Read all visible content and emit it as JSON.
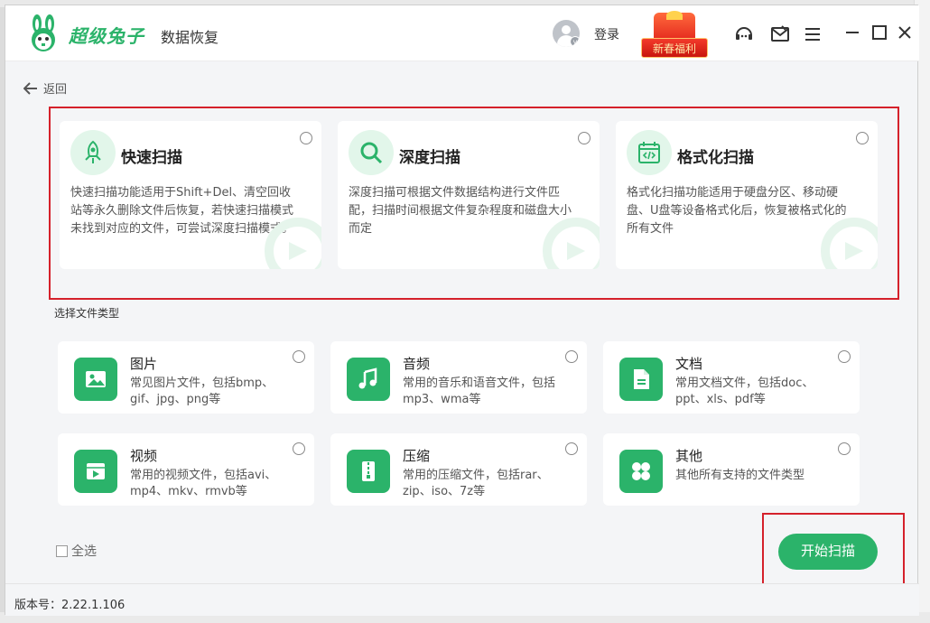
{
  "header": {
    "brand": "超级兔子",
    "subbrand": "数据恢复",
    "login_label": "登录",
    "promo_label": "新春福利"
  },
  "nav": {
    "back_label": "返回"
  },
  "scan_modes": [
    {
      "title": "快速扫描",
      "desc": "快速扫描功能适用于Shift+Del、清空回收站等永久删除文件后恢复，若快速扫描模式未找到对应的文件，可尝试深度扫描模式。",
      "icon": "rocket-icon"
    },
    {
      "title": "深度扫描",
      "desc": "深度扫描可根据文件数据结构进行文件匹配，扫描时间根据文件复杂程度和磁盘大小而定",
      "icon": "magnifier-icon"
    },
    {
      "title": "格式化扫描",
      "desc": "格式化扫描功能适用于硬盘分区、移动硬盘、U盘等设备格式化后，恢复被格式化的所有文件",
      "icon": "calendar-code-icon"
    }
  ],
  "file_types_label": "选择文件类型",
  "file_types": [
    {
      "title": "图片",
      "desc": "常见图片文件，包括bmp、gif、jpg、png等",
      "icon": "image-icon"
    },
    {
      "title": "音频",
      "desc": "常用的音乐和语音文件，包括mp3、wma等",
      "icon": "music-icon"
    },
    {
      "title": "文档",
      "desc": "常用文档文件，包括doc、ppt、xls、pdf等",
      "icon": "document-icon"
    },
    {
      "title": "视频",
      "desc": "常用的视频文件，包括avi、mp4、mkv、rmvb等",
      "icon": "video-icon"
    },
    {
      "title": "压缩",
      "desc": "常用的压缩文件，包括rar、zip、iso、7z等",
      "icon": "zip-icon"
    },
    {
      "title": "其他",
      "desc": "其他所有支持的文件类型",
      "icon": "grid-icon"
    }
  ],
  "select_all_label": "全选",
  "start_label": "开始扫描",
  "version_text": "版本号：2.22.1.106",
  "colors": {
    "accent": "#2bb36a",
    "highlight": "#d5212b"
  }
}
